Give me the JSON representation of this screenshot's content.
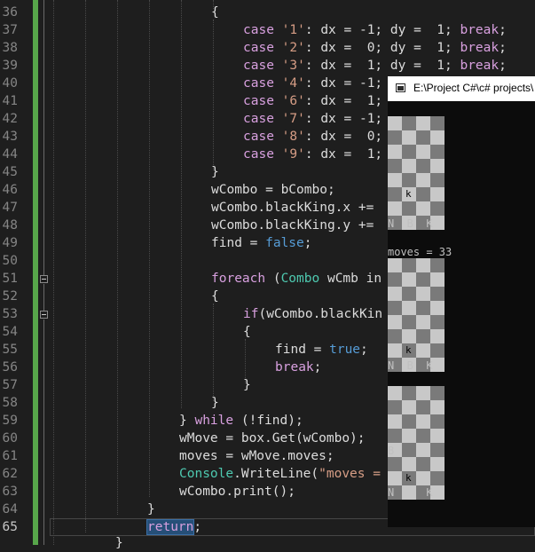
{
  "editor": {
    "line_numbers": [
      "36",
      "37",
      "38",
      "39",
      "40",
      "41",
      "42",
      "43",
      "44",
      "45",
      "46",
      "47",
      "48",
      "49",
      "50",
      "51",
      "52",
      "53",
      "54",
      "55",
      "56",
      "57",
      "58",
      "59",
      "60",
      "61",
      "62",
      "63",
      "64",
      "65"
    ],
    "current_line": "65",
    "code": {
      "l36": "{",
      "l37": [
        "case ",
        "'1'",
        ": dx = -1; dy =  1; ",
        "break",
        ";"
      ],
      "l38": [
        "case ",
        "'2'",
        ": dx =  0; dy =  1; ",
        "break",
        ";"
      ],
      "l39": [
        "case ",
        "'3'",
        ": dx =  1; dy =  1; ",
        "break",
        ";"
      ],
      "l40": [
        "case ",
        "'4'",
        ": dx = -1;"
      ],
      "l41": [
        "case ",
        "'6'",
        ": dx =  1;"
      ],
      "l42": [
        "case ",
        "'7'",
        ": dx = -1;"
      ],
      "l43": [
        "case ",
        "'8'",
        ": dx =  0;"
      ],
      "l44": [
        "case ",
        "'9'",
        ": dx =  1;"
      ],
      "l45": "}",
      "l46": "wCombo = bCombo;",
      "l47": "wCombo.blackKing.x +=",
      "l48": "wCombo.blackKing.y +=",
      "l49": [
        "find = ",
        "false",
        ";"
      ],
      "l51": [
        "foreach",
        " (",
        "Combo",
        " wCmb in"
      ],
      "l52": "{",
      "l53": [
        "if",
        "(wCombo.blackKin"
      ],
      "l54": "{",
      "l55": [
        "find = ",
        "true",
        ";"
      ],
      "l56": [
        "break",
        ";"
      ],
      "l57": "}",
      "l58": "}",
      "l59": [
        "} ",
        "while",
        " (!find);"
      ],
      "l60": "wMove = box.Get(wCombo);",
      "l61": "moves = wMove.moves;",
      "l62": [
        "Console",
        ".WriteLine(",
        "\"moves ="
      ],
      "l63": "wCombo.print();",
      "l64": "}",
      "l65": [
        "return",
        ";"
      ],
      "l66": "}"
    }
  },
  "console": {
    "title": "E:\\Project C#\\c# projects\\",
    "moves_text": "moves = 33",
    "boards": [
      {
        "king": "k",
        "labels": "N  B  K",
        "left_letter": ""
      },
      {
        "king": "k",
        "labels": "N  B  K",
        "left_letter": ""
      },
      {
        "king": "k",
        "labels": "N     K",
        "left_letter": "B"
      }
    ]
  },
  "colors": {
    "background": "#1e1e1e",
    "keyword": "#569cd6",
    "control": "#d8a0df",
    "string": "#d69d85",
    "type": "#4ec9b0",
    "change_bar": "#57a64a"
  }
}
